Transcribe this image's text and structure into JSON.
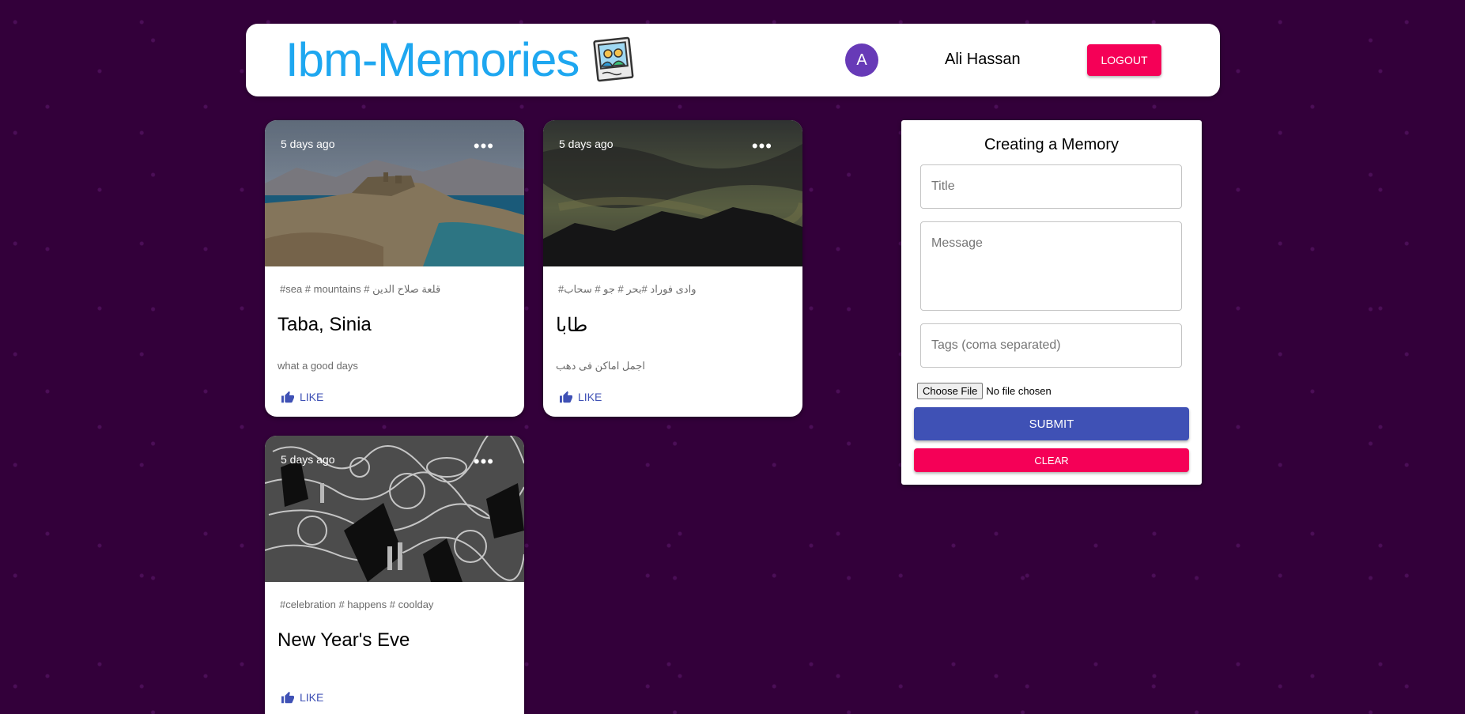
{
  "appbar": {
    "title": "Ibm-Memories",
    "logo_icon": "memories-photo-icon",
    "avatar_letter": "A",
    "user_name": "Ali Hassan",
    "logout_label": "LOGOUT",
    "colors": {
      "title": "#1ea7f0",
      "avatar": "#673ab7",
      "logout": "#f50057"
    }
  },
  "posts": [
    {
      "time": "5 days ago",
      "tags": "#sea # mountains # قلعة صلاح الدين",
      "title": "Taba, Sinia",
      "message": "what a good days",
      "like_label": "LIKE"
    },
    {
      "time": "5 days ago",
      "tags": "#وادى فوراد #بحر # جو # سحاب",
      "title": "طابا",
      "message": "اجمل اماكن فى دهب",
      "like_label": "LIKE"
    },
    {
      "time": "5 days ago",
      "tags": "#celebration # happens # coolday",
      "title": "New Year's Eve",
      "message": "",
      "like_label": "LIKE"
    }
  ],
  "form": {
    "heading": "Creating a Memory",
    "title_placeholder": "Title",
    "message_placeholder": "Message",
    "tags_placeholder": "Tags (coma separated)",
    "choose_file_label": "Choose File",
    "no_file_label": "No file chosen",
    "submit_label": "SUBMIT",
    "clear_label": "CLEAR",
    "colors": {
      "submit": "#3f51b5",
      "clear": "#f50057"
    }
  },
  "background_color": "#33003a"
}
